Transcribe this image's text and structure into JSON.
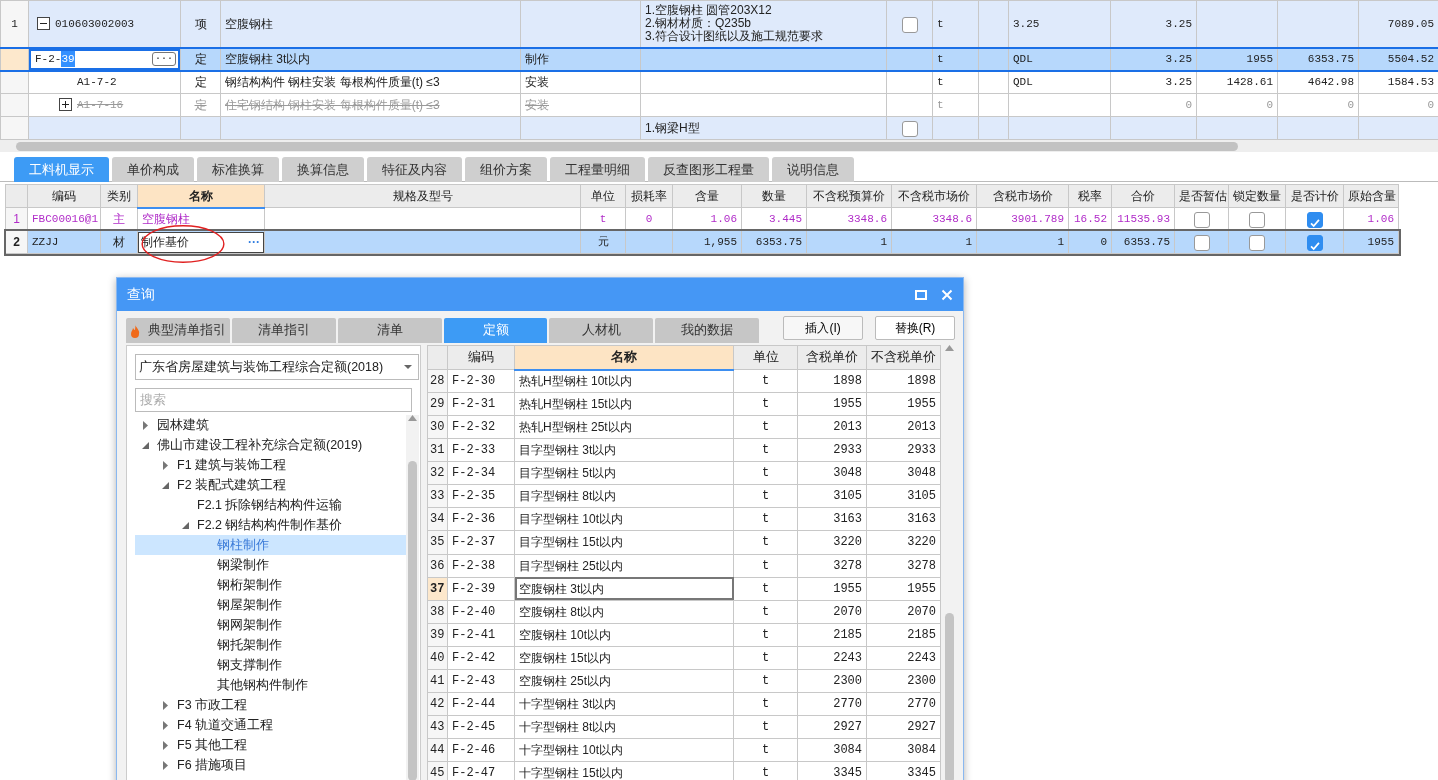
{
  "main_table": {
    "rows": [
      {
        "kind": "item",
        "num": "1",
        "expanded": true,
        "code": "010603002003",
        "type": "项",
        "name": "空腹钢柱",
        "features": [
          "1.空腹钢柱 圆管203X12",
          "2.钢材材质：Q235b",
          "3.符合设计图纸以及施工规范要求"
        ],
        "checked": false,
        "unit": "t",
        "c11": "3.25",
        "c12": "3.25",
        "c15": "7089.05",
        "children": [
          {
            "kind": "selected",
            "code_prefix": "F-2-",
            "code_selected_part": "39",
            "ellipsis": "···",
            "type": "定",
            "name": "空腹钢柱 3t以内",
            "sub": "制作",
            "unit": "t",
            "c11": "QDL",
            "c12": "3.25",
            "c13": "1955",
            "c14": "6353.75",
            "c15": "5504.52"
          },
          {
            "kind": "normal",
            "code": "A1-7-2",
            "type": "定",
            "name": "钢结构构件 钢柱安装 每根构件质量(t) ≤3",
            "sub": "安装",
            "unit": "t",
            "c11": "QDL",
            "c12": "3.25",
            "c13": "1428.61",
            "c14": "4642.98",
            "c15": "1584.53"
          },
          {
            "kind": "disabled",
            "expanded": false,
            "code": "A1-7-16",
            "type": "定",
            "name": "住宅钢结构 钢柱安装 每根构件质量(t) ≤3",
            "sub": "安装",
            "unit": "t",
            "c12": "0",
            "c13": "0",
            "c14": "0",
            "c15": "0"
          }
        ]
      },
      {
        "kind": "item",
        "features": [
          "1.钢梁H型"
        ],
        "checked": false
      }
    ]
  },
  "bottom_tabs": [
    {
      "label": "工料机显示",
      "selected": true
    },
    {
      "label": "单价构成",
      "selected": false
    },
    {
      "label": "标准换算",
      "selected": false
    },
    {
      "label": "换算信息",
      "selected": false
    },
    {
      "label": "特征及内容",
      "selected": false
    },
    {
      "label": "组价方案",
      "selected": false
    },
    {
      "label": "工程量明细",
      "selected": false
    },
    {
      "label": "反查图形工程量",
      "selected": false
    },
    {
      "label": "说明信息",
      "selected": false
    }
  ],
  "resource_table": {
    "columns": [
      {
        "label": "编码",
        "highlighted": false
      },
      {
        "label": "类别",
        "highlighted": false
      },
      {
        "label": "名称",
        "highlighted": true
      },
      {
        "label": "规格及型号",
        "highlighted": false
      },
      {
        "label": "单位",
        "highlighted": false
      },
      {
        "label": "损耗率",
        "highlighted": false
      },
      {
        "label": "含量",
        "highlighted": false
      },
      {
        "label": "数量",
        "highlighted": false
      },
      {
        "label": "不含税预算价",
        "highlighted": false
      },
      {
        "label": "不含税市场价",
        "highlighted": false
      },
      {
        "label": "含税市场价",
        "highlighted": false
      },
      {
        "label": "税率",
        "highlighted": false
      },
      {
        "label": "合价",
        "highlighted": false
      },
      {
        "label": "是否暂估",
        "highlighted": false
      },
      {
        "label": "锁定数量",
        "highlighted": false
      },
      {
        "label": "是否计价",
        "highlighted": false
      },
      {
        "label": "原始含量",
        "highlighted": false
      }
    ],
    "rows": [
      {
        "kind": "main",
        "selected": false,
        "num": "1",
        "code": "FBC00016@1",
        "category": "主",
        "name": "空腹钢柱",
        "unit": "t",
        "loss": "0",
        "content": "1.06",
        "quantity": "3.445",
        "budget_price": "3348.6",
        "market_price": "3348.6",
        "market_price_tax": "3901.789",
        "tax_rate": "16.52",
        "total": "11535.93",
        "estimated": false,
        "locked": false,
        "priced": true,
        "original_content": "1.06"
      },
      {
        "kind": "material",
        "selected": true,
        "num": "2",
        "code": "ZZJJ",
        "category": "材",
        "name": "制作基价",
        "ellipsis": "···",
        "unit": "元",
        "content": "1,955",
        "quantity": "6353.75",
        "budget_price": "1",
        "market_price": "1",
        "market_price_tax": "1",
        "tax_rate": "0",
        "total": "6353.75",
        "estimated": false,
        "locked": false,
        "priced": true,
        "original_content": "1955"
      }
    ]
  },
  "dialog": {
    "title": "查询",
    "tabs": [
      {
        "label": "典型清单指引",
        "kind": "fire",
        "selected": false
      },
      {
        "label": "清单指引",
        "kind": "plain",
        "selected": false
      },
      {
        "label": "清单",
        "kind": "plain",
        "selected": false
      },
      {
        "label": "定额",
        "kind": "plain",
        "selected": true
      },
      {
        "label": "人材机",
        "kind": "plain",
        "selected": false
      },
      {
        "label": "我的数据",
        "kind": "plain",
        "selected": false
      }
    ],
    "buttons": [
      "插入(I)",
      "替换(R)"
    ],
    "library": "广东省房屋建筑与装饰工程综合定额(2018)",
    "search": {
      "placeholder": "搜索"
    },
    "tree": [
      {
        "label": "园林建筑",
        "expanded": false,
        "selected": false
      },
      {
        "label": "佛山市建设工程补充综合定额(2019)",
        "expanded": true,
        "selected": false,
        "children": [
          {
            "label": "F1 建筑与装饰工程",
            "expanded": false,
            "selected": false
          },
          {
            "label": "F2 装配式建筑工程",
            "expanded": true,
            "selected": false,
            "children": [
              {
                "label": "F2.1 拆除钢结构构件运输",
                "selected": false
              },
              {
                "label": "F2.2 钢结构构件制作基价",
                "expanded": true,
                "selected": false,
                "children": [
                  {
                    "label": "钢柱制作",
                    "selected": true
                  },
                  {
                    "label": "钢梁制作",
                    "selected": false
                  },
                  {
                    "label": "钢桁架制作",
                    "selected": false
                  },
                  {
                    "label": "钢屋架制作",
                    "selected": false
                  },
                  {
                    "label": "钢网架制作",
                    "selected": false
                  },
                  {
                    "label": "钢托架制作",
                    "selected": false
                  },
                  {
                    "label": "钢支撑制作",
                    "selected": false
                  },
                  {
                    "label": "其他钢构件制作",
                    "selected": false
                  }
                ]
              }
            ]
          },
          {
            "label": "F3 市政工程",
            "expanded": false,
            "selected": false
          },
          {
            "label": "F4 轨道交通工程",
            "expanded": false,
            "selected": false
          },
          {
            "label": "F5 其他工程",
            "expanded": false,
            "selected": false
          },
          {
            "label": "F6 措施项目",
            "expanded": false,
            "selected": false
          }
        ]
      }
    ],
    "table": {
      "columns": [
        {
          "label": "编码",
          "highlighted": false
        },
        {
          "label": "名称",
          "highlighted": true
        },
        {
          "label": "单位",
          "highlighted": false
        },
        {
          "label": "含税单价",
          "highlighted": false
        },
        {
          "label": "不含税单价",
          "highlighted": false
        }
      ],
      "rows": [
        {
          "num": "28",
          "code": "F-2-30",
          "name": "热轧H型钢柱 10t以内",
          "unit": "t",
          "price_tax": "1898",
          "price": "1898",
          "selected": false
        },
        {
          "num": "29",
          "code": "F-2-31",
          "name": "热轧H型钢柱 15t以内",
          "unit": "t",
          "price_tax": "1955",
          "price": "1955",
          "selected": false
        },
        {
          "num": "30",
          "code": "F-2-32",
          "name": "热轧H型钢柱 25t以内",
          "unit": "t",
          "price_tax": "2013",
          "price": "2013",
          "selected": false
        },
        {
          "num": "31",
          "code": "F-2-33",
          "name": "目字型钢柱 3t以内",
          "unit": "t",
          "price_tax": "2933",
          "price": "2933",
          "selected": false
        },
        {
          "num": "32",
          "code": "F-2-34",
          "name": "目字型钢柱 5t以内",
          "unit": "t",
          "price_tax": "3048",
          "price": "3048",
          "selected": false
        },
        {
          "num": "33",
          "code": "F-2-35",
          "name": "目字型钢柱 8t以内",
          "unit": "t",
          "price_tax": "3105",
          "price": "3105",
          "selected": false
        },
        {
          "num": "34",
          "code": "F-2-36",
          "name": "目字型钢柱 10t以内",
          "unit": "t",
          "price_tax": "3163",
          "price": "3163",
          "selected": false
        },
        {
          "num": "35",
          "code": "F-2-37",
          "name": "目字型钢柱 15t以内",
          "unit": "t",
          "price_tax": "3220",
          "price": "3220",
          "selected": false
        },
        {
          "num": "36",
          "code": "F-2-38",
          "name": "目字型钢柱 25t以内",
          "unit": "t",
          "price_tax": "3278",
          "price": "3278",
          "selected": false
        },
        {
          "num": "37",
          "code": "F-2-39",
          "name": "空腹钢柱 3t以内",
          "unit": "t",
          "price_tax": "1955",
          "price": "1955",
          "selected": true
        },
        {
          "num": "38",
          "code": "F-2-40",
          "name": "空腹钢柱 8t以内",
          "unit": "t",
          "price_tax": "2070",
          "price": "2070",
          "selected": false
        },
        {
          "num": "39",
          "code": "F-2-41",
          "name": "空腹钢柱 10t以内",
          "unit": "t",
          "price_tax": "2185",
          "price": "2185",
          "selected": false
        },
        {
          "num": "40",
          "code": "F-2-42",
          "name": "空腹钢柱 15t以内",
          "unit": "t",
          "price_tax": "2243",
          "price": "2243",
          "selected": false
        },
        {
          "num": "41",
          "code": "F-2-43",
          "name": "空腹钢柱 25t以内",
          "unit": "t",
          "price_tax": "2300",
          "price": "2300",
          "selected": false
        },
        {
          "num": "42",
          "code": "F-2-44",
          "name": "十字型钢柱 3t以内",
          "unit": "t",
          "price_tax": "2770",
          "price": "2770",
          "selected": false
        },
        {
          "num": "43",
          "code": "F-2-45",
          "name": "十字型钢柱 8t以内",
          "unit": "t",
          "price_tax": "2927",
          "price": "2927",
          "selected": false
        },
        {
          "num": "44",
          "code": "F-2-46",
          "name": "十字型钢柱 10t以内",
          "unit": "t",
          "price_tax": "3084",
          "price": "3084",
          "selected": false
        },
        {
          "num": "45",
          "code": "F-2-47",
          "name": "十字型钢柱 15t以内",
          "unit": "t",
          "price_tax": "3345",
          "price": "3345",
          "selected": false
        }
      ]
    }
  }
}
